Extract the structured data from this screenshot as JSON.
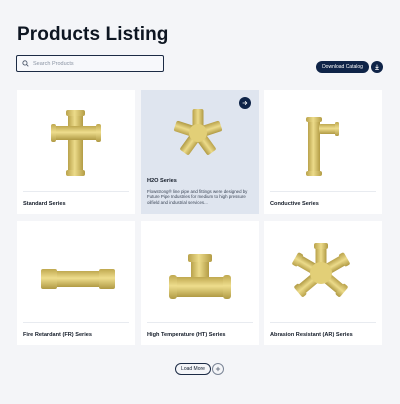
{
  "page": {
    "title": "Products Listing"
  },
  "search": {
    "placeholder": "Search Products"
  },
  "actions": {
    "download_label": "Download Catalog",
    "download_icon": "download-icon"
  },
  "products": [
    {
      "name": "Standard Series",
      "icon": "cross-fitting-icon"
    },
    {
      "name": "H2O Series",
      "icon": "five-way-fitting-icon",
      "active": true,
      "description": "Flowstrong® line pipe and fittings were designed by Future Pipe Industries for medium to high pressure oilfield and industrial services..."
    },
    {
      "name": "Conductive Series",
      "icon": "tee-fitting-icon"
    },
    {
      "name": "Fire Retardant (FR) Series",
      "icon": "coupling-icon"
    },
    {
      "name": "High Temperature (HT) Series",
      "icon": "tee-fitting-icon"
    },
    {
      "name": "Abrasion Resistant (AR) Series",
      "icon": "multi-way-fitting-icon"
    }
  ],
  "pagination": {
    "load_more_label": "Load More",
    "plus_icon": "plus-icon"
  },
  "colors": {
    "accent": "#0f2448",
    "pipe": "#e2cf77",
    "active_card": "#dfe5ef",
    "background": "#f4f5f8"
  }
}
